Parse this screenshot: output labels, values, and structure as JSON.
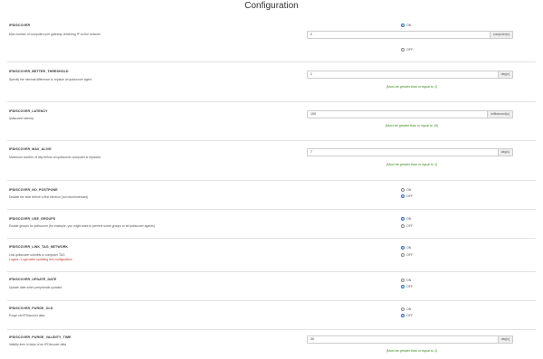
{
  "page": {
    "title": "Configuration"
  },
  "settings": [
    {
      "name": "IPDISCOVER",
      "desc": "Max number of computers per gateway retrieving IP on the network",
      "on_label": "ON",
      "off_label": "OFF",
      "selected": "on",
      "value": "2",
      "unit": "computer(s)"
    },
    {
      "name": "IPDISCOVER_BETTER_THRESHOLD",
      "desc": "Specify the minimal difference to replace an ipdiscover agent",
      "value": "1",
      "unit": "day(s)",
      "hint": "(Must be greater than or equal to 1)"
    },
    {
      "name": "IPDISCOVER_LATENCY",
      "desc": "Ipdiscover latency",
      "value": "100",
      "unit": "millisecond(s)",
      "hint": "(Must be greater than or equal to 10)"
    },
    {
      "name": "IPDISCOVER_MAX_ALIVE",
      "desc": "Maximum number of day before an ipdiscover computer is replaced",
      "value": "7",
      "unit": "day(s)",
      "hint": "(Must be greater than or equal to 1)"
    },
    {
      "name": "IPDISCOVER_NO_POSTPONE",
      "desc": "Disable the time before a first election (not recommended)",
      "on_label": "ON",
      "off_label": "OFF",
      "selected": "off"
    },
    {
      "name": "IPDISCOVER_USE_GROUPS",
      "desc": "Enable groups for ipdiscover (for example, you might want to prevent some groups to be ipdiscover agents)",
      "on_label": "ON",
      "off_label": "OFF",
      "selected": "on"
    },
    {
      "name": "IPDISCOVER_LINK_TAG_NETWORK",
      "desc": "Link ipdiscover subnets to computer TAG",
      "warn": "Logout / Login after updating this configuration",
      "on_label": "ON",
      "off_label": "OFF",
      "selected": "on"
    },
    {
      "name": "IPDISCOVER_UPDATE_DATE",
      "desc": "Update date when peripherals updated",
      "on_label": "ON",
      "off_label": "OFF",
      "selected": "off"
    },
    {
      "name": "IPDISCOVER_PURGE_OLD",
      "desc": "Purge old IPDiscover data",
      "on_label": "ON",
      "off_label": "OFF",
      "selected": "off"
    },
    {
      "name": "IPDISCOVER_PURGE_VALIDITY_TIME",
      "desc": "Validity time in days of an IPDiscover data",
      "value": "30",
      "unit": "day(s)",
      "hint": "(Must be greater than or equal to 1)"
    }
  ]
}
